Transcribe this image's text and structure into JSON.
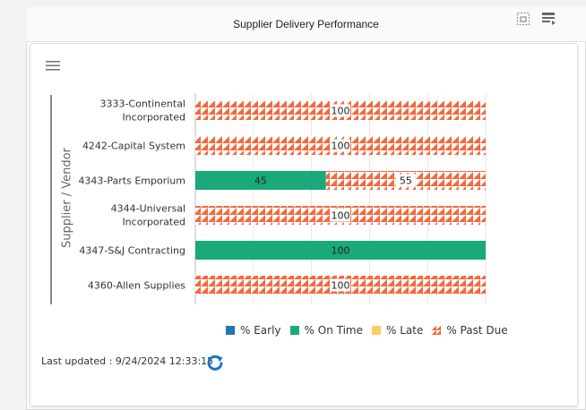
{
  "widget": {
    "title": "Supplier Delivery Performance",
    "last_updated": "Last updated : 9/24/2024 12:33:15"
  },
  "icons": {
    "expand": "expand-icon",
    "table": "table-view-icon",
    "menu": "hamburger-menu-icon",
    "refresh": "refresh-icon"
  },
  "chart_data": {
    "type": "bar",
    "orientation": "horizontal",
    "stacked": true,
    "ylabel": "Supplier / Vendor",
    "categories": [
      [
        "3333-Continental",
        "Incorporated"
      ],
      [
        "4242-Capital System"
      ],
      [
        "4343-Parts Emporium"
      ],
      [
        "4344-Universal",
        "Incorporated"
      ],
      [
        "4347-S&J Contracting"
      ],
      [
        "4360-Allen Supplies"
      ]
    ],
    "series": [
      {
        "name": "% Early",
        "color": "#1f77b4",
        "values": [
          0,
          0,
          0,
          0,
          0,
          0
        ]
      },
      {
        "name": "% On Time",
        "color": "#1aa97a",
        "values": [
          0,
          0,
          45,
          0,
          100,
          0
        ]
      },
      {
        "name": "% Late",
        "color": "#ffcc66",
        "values": [
          0,
          0,
          0,
          0,
          0,
          0
        ]
      },
      {
        "name": "% Past Due",
        "color": "#f4693e",
        "pattern": "hatched",
        "values": [
          100,
          100,
          55,
          100,
          0,
          100
        ]
      }
    ],
    "xlim": [
      0,
      100
    ],
    "grid": true,
    "legend": "bottom"
  }
}
